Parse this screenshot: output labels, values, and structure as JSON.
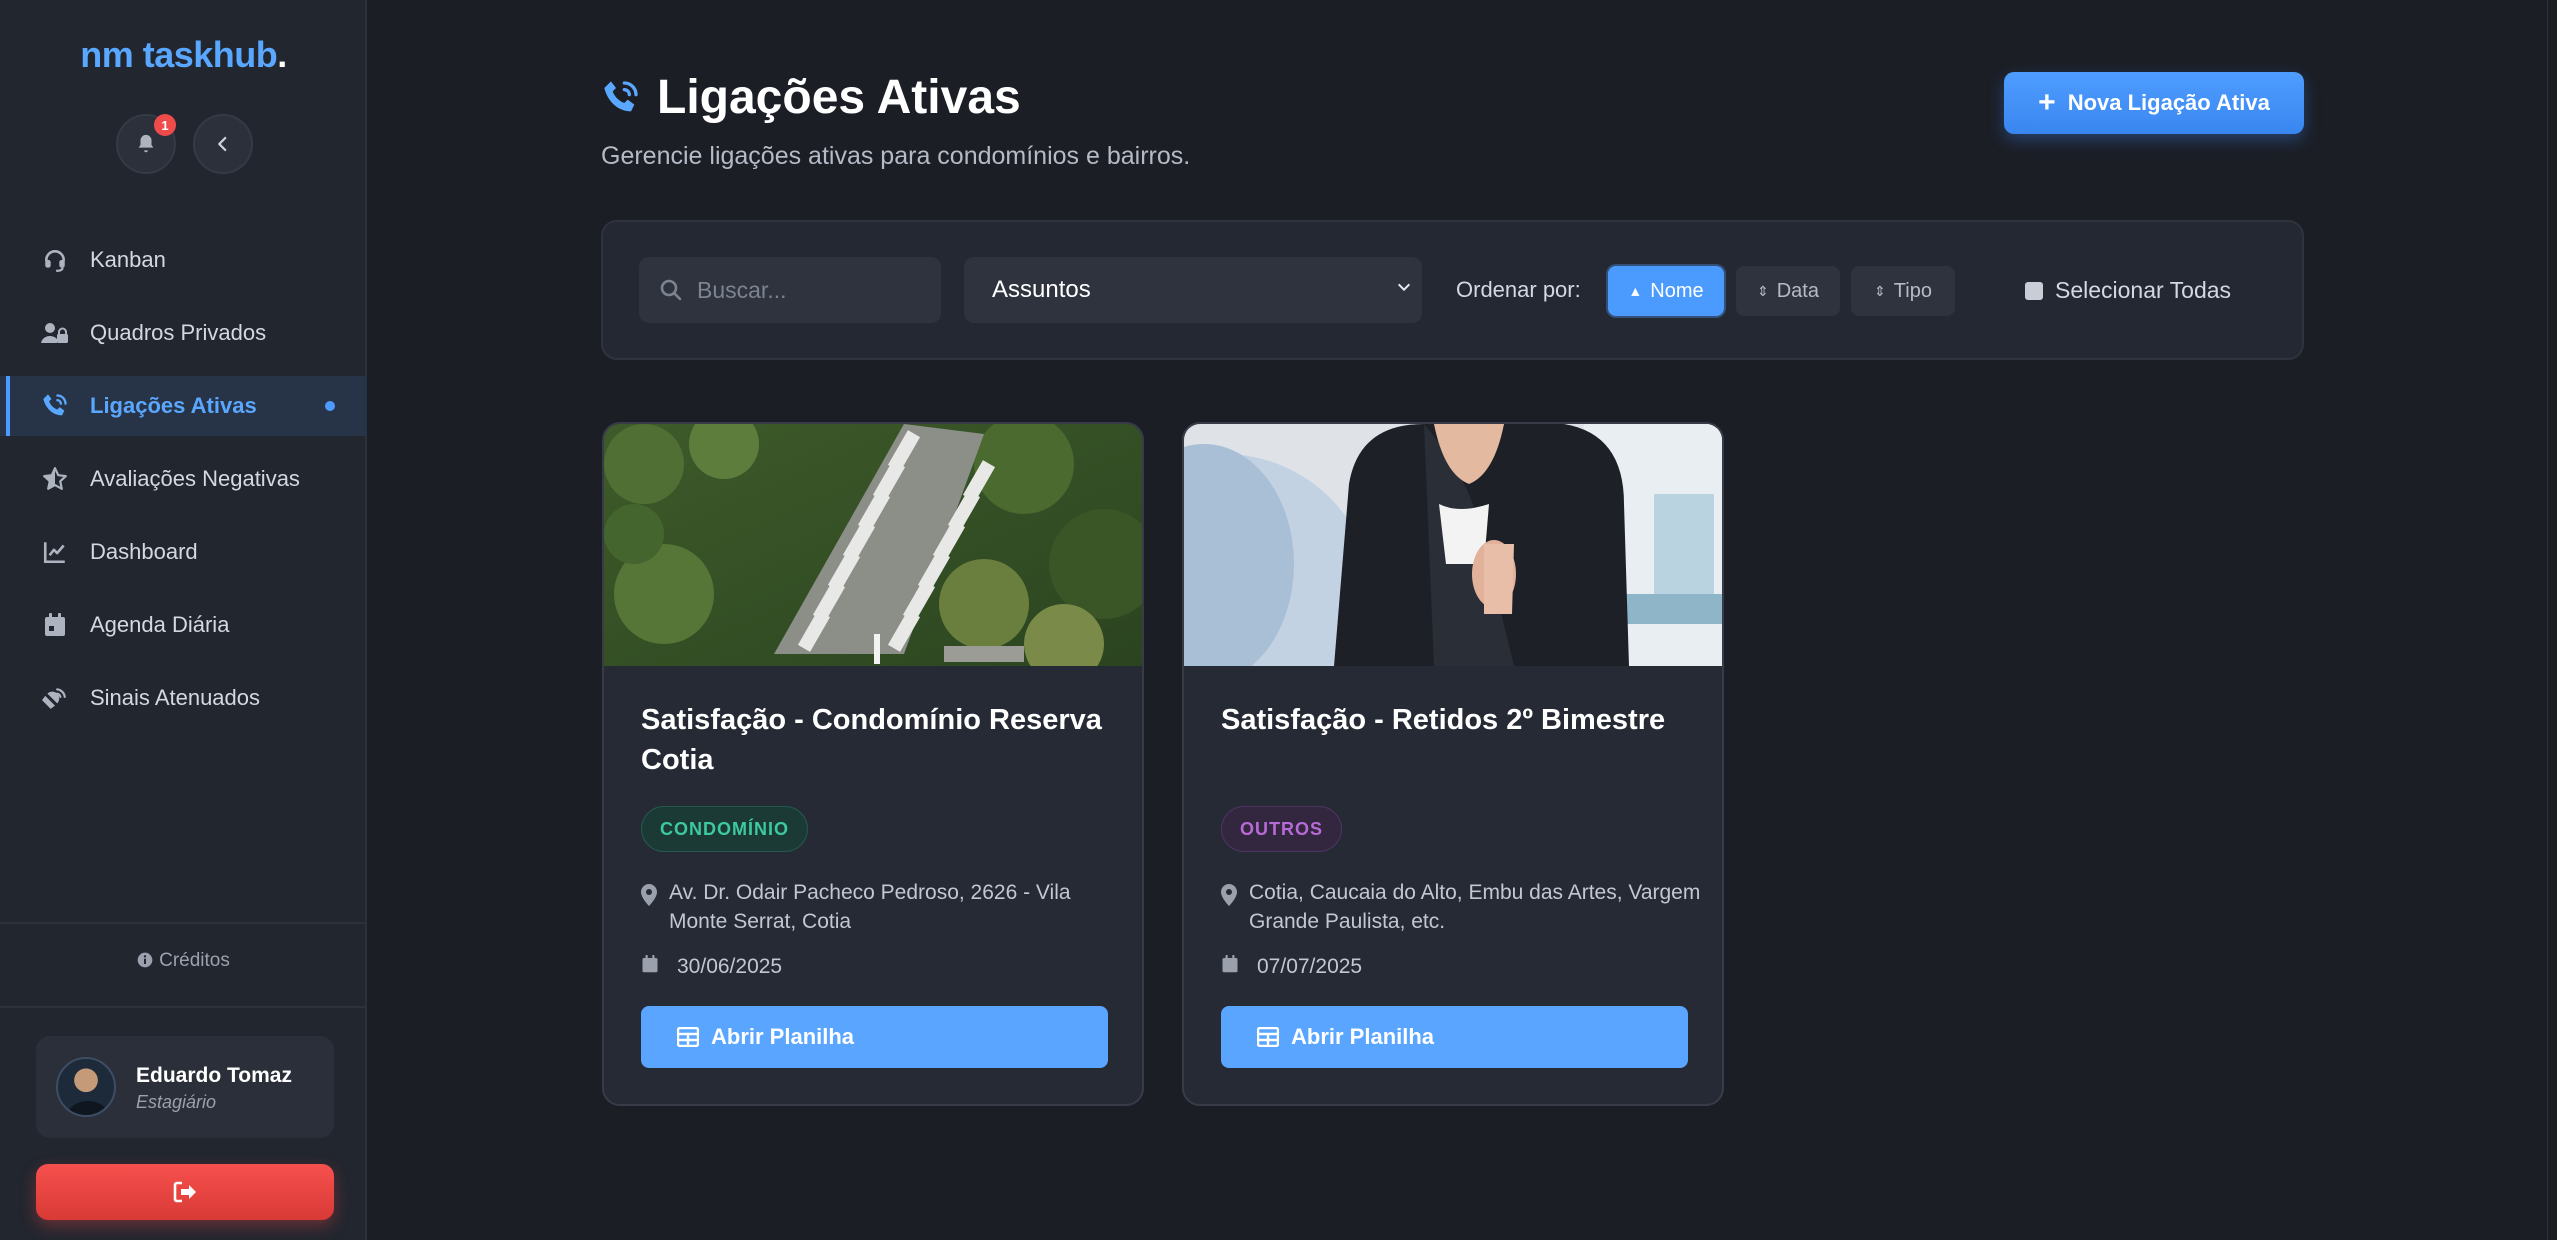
{
  "sidebar": {
    "logo_main": "nm taskhub",
    "logo_dot": ".",
    "notification_count": "1",
    "items": [
      {
        "label": "Kanban",
        "icon": "headset-icon"
      },
      {
        "label": "Quadros Privados",
        "icon": "user-lock-icon"
      },
      {
        "label": "Ligações Ativas",
        "icon": "phone-volume-icon",
        "active": true
      },
      {
        "label": "Avaliações Negativas",
        "icon": "star-half-icon"
      },
      {
        "label": "Dashboard",
        "icon": "chart-line-icon"
      },
      {
        "label": "Agenda Diária",
        "icon": "calendar-icon"
      },
      {
        "label": "Sinais Atenuados",
        "icon": "satellite-dish-icon"
      }
    ],
    "credits": "Créditos",
    "user": {
      "name": "Eduardo Tomaz",
      "role": "Estagiário"
    }
  },
  "header": {
    "title": "Ligações Ativas",
    "subtitle": "Gerencie ligações ativas para condomínios e bairros.",
    "new_button": "Nova Ligação Ativa"
  },
  "filters": {
    "search_placeholder": "Buscar...",
    "subject_select": "Assuntos",
    "order_label": "Ordenar por:",
    "sort_name": "Nome",
    "sort_date": "Data",
    "sort_type": "Tipo",
    "select_all": "Selecionar Todas"
  },
  "cards": [
    {
      "title": "Satisfação - Condomínio Reserva Cotia",
      "tag": "CONDOMÍNIO",
      "location": "Av. Dr. Odair Pacheco Pedroso, 2626 - Vila Monte Serrat, Cotia",
      "date": "30/06/2025",
      "button": "Abrir Planilha"
    },
    {
      "title": "Satisfação - Retidos 2º Bimestre",
      "tag": "OUTROS",
      "location": "Cotia, Caucaia do Alto, Embu das Artes, Vargem Grande Paulista, etc.",
      "date": "07/07/2025",
      "button": "Abrir Planilha"
    }
  ],
  "colors": {
    "accent": "#4d9bff",
    "danger": "#e5443f",
    "tag_green": "#3dc9a0",
    "tag_purple": "#b86ad8"
  }
}
